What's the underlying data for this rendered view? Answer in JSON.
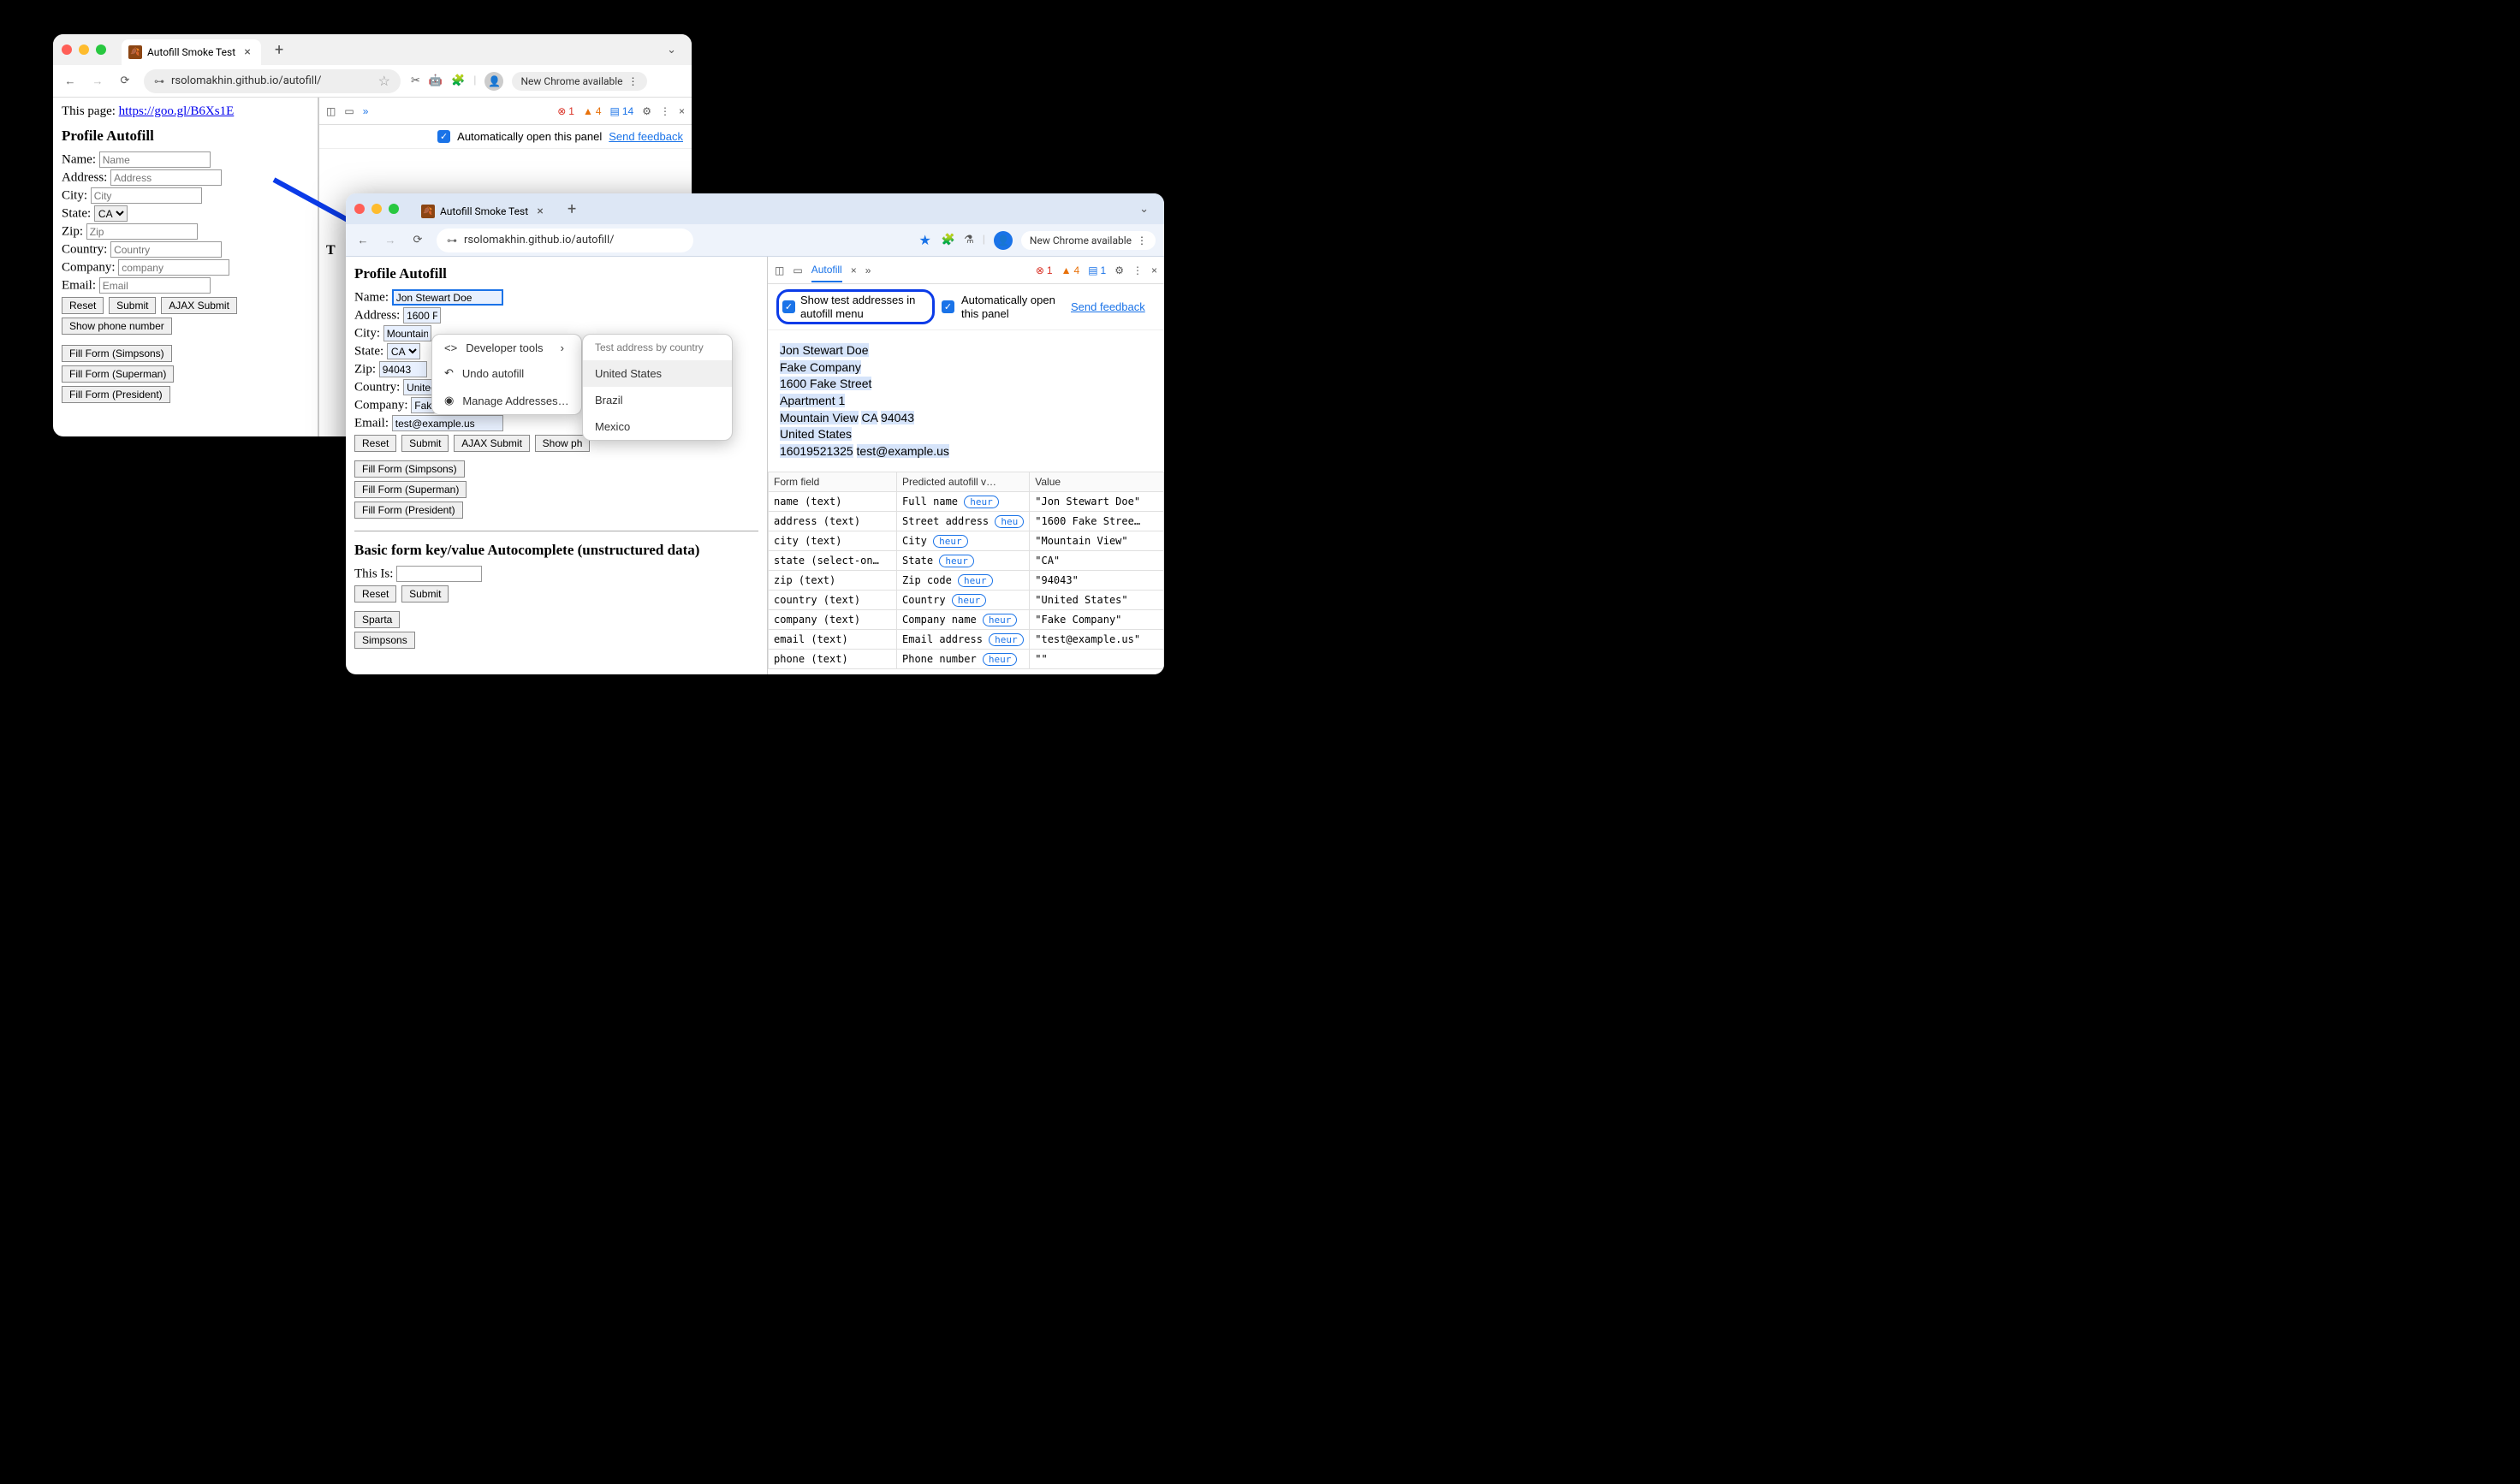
{
  "win1": {
    "tab_title": "Autofill Smoke Test",
    "url": "rsolomakhin.github.io/autofill/",
    "update_chip": "New Chrome available",
    "page_intro": "This page: ",
    "page_link": "https://goo.gl/B6Xs1E",
    "heading": "Profile Autofill",
    "fields": {
      "name_label": "Name:",
      "name_ph": "Name",
      "address_label": "Address:",
      "address_ph": "Address",
      "city_label": "City:",
      "city_ph": "City",
      "state_label": "State:",
      "state_val": "CA",
      "zip_label": "Zip:",
      "zip_ph": "Zip",
      "country_label": "Country:",
      "country_ph": "Country",
      "company_label": "Company:",
      "company_ph": "company",
      "email_label": "Email:",
      "email_ph": "Email"
    },
    "buttons": {
      "reset": "Reset",
      "submit": "Submit",
      "ajax": "AJAX Submit",
      "show_phone": "Show phone number",
      "fill1": "Fill Form (Simpsons)",
      "fill2": "Fill Form (Superman)",
      "fill3": "Fill Form (President)"
    },
    "devtools": {
      "errors": "1",
      "warnings": "4",
      "messages": "14",
      "auto_open": "Automatically open this panel",
      "feedback": "Send feedback",
      "partial_t": "T"
    }
  },
  "win2": {
    "tab_title": "Autofill Smoke Test",
    "url": "rsolomakhin.github.io/autofill/",
    "update_chip": "New Chrome available",
    "heading": "Profile Autofill",
    "fields": {
      "name_label": "Name:",
      "name_val": "Jon Stewart Doe",
      "address_label": "Address:",
      "address_val": "1600 F",
      "city_label": "City:",
      "city_val": "Mountain",
      "state_label": "State:",
      "state_val": "CA",
      "zip_label": "Zip:",
      "zip_val": "94043",
      "country_label": "Country:",
      "country_val": "United",
      "company_label": "Company:",
      "company_val": "Fake",
      "email_label": "Email:",
      "email_val": "test@example.us"
    },
    "buttons": {
      "reset": "Reset",
      "submit": "Submit",
      "ajax": "AJAX Submit",
      "show_phone": "Show ph",
      "fill1": "Fill Form (Simpsons)",
      "fill2": "Fill Form (Superman)",
      "fill3": "Fill Form (President)"
    },
    "section2_heading": "Basic form key/value Autocomplete (unstructured data)",
    "this_is": "This Is:",
    "sparta": "Sparta",
    "simpsons": "Simpsons",
    "devtools": {
      "tab": "Autofill",
      "errors": "1",
      "warnings": "4",
      "messages": "1",
      "opt1": "Show test addresses in autofill menu",
      "opt2": "Automatically open this panel",
      "feedback": "Send feedback",
      "table_headers": {
        "c1": "Form field",
        "c2": "Predicted autofill v…",
        "c3": "Value"
      }
    },
    "card": {
      "name": "Jon Stewart Doe",
      "company": "Fake Company",
      "street": "1600 Fake Street",
      "apt": "Apartment 1",
      "city": "Mountain View",
      "state": "CA",
      "zip": "94043",
      "country": "United States",
      "phone": "16019521325",
      "email": "test@example.us"
    },
    "table_rows": [
      {
        "f": "name (text)",
        "p": "Full name",
        "h": "heur",
        "v": "\"Jon Stewart Doe\""
      },
      {
        "f": "address (text)",
        "p": "Street address",
        "h": "heu",
        "v": "\"1600 Fake Stree…"
      },
      {
        "f": "city (text)",
        "p": "City",
        "h": "heur",
        "v": "\"Mountain View\""
      },
      {
        "f": "state (select-on…",
        "p": "State",
        "h": "heur",
        "v": "\"CA\""
      },
      {
        "f": "zip (text)",
        "p": "Zip code",
        "h": "heur",
        "v": "\"94043\""
      },
      {
        "f": "country (text)",
        "p": "Country",
        "h": "heur",
        "v": "\"United States\""
      },
      {
        "f": "company (text)",
        "p": "Company name",
        "h": "heur",
        "v": "\"Fake Company\""
      },
      {
        "f": "email (text)",
        "p": "Email address",
        "h": "heur",
        "v": "\"test@example.us\""
      },
      {
        "f": "phone (text)",
        "p": "Phone number",
        "h": "heur",
        "v": "\"\""
      }
    ]
  },
  "popup1": {
    "dev_tools": "Developer tools",
    "undo": "Undo autofill",
    "manage": "Manage Addresses…"
  },
  "popup2": {
    "title": "Test address by country",
    "items": [
      "United States",
      "Brazil",
      "Mexico"
    ]
  }
}
